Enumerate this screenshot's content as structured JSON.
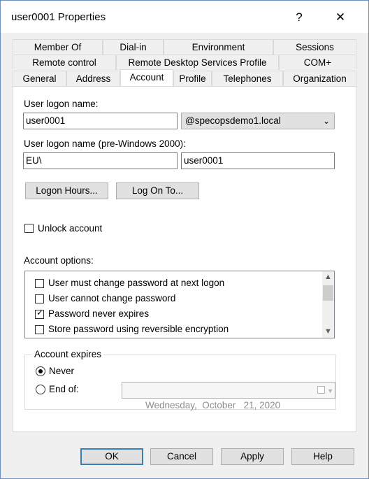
{
  "window": {
    "title": "user0001 Properties",
    "help_glyph": "?",
    "close_glyph": "✕"
  },
  "tabs": {
    "row1": [
      "Member Of",
      "Dial-in",
      "Environment",
      "Sessions"
    ],
    "row2": [
      "Remote control",
      "Remote Desktop Services Profile",
      "COM+"
    ],
    "row3": [
      "General",
      "Address",
      "Account",
      "Profile",
      "Telephones",
      "Organization"
    ],
    "active": "Account"
  },
  "logon": {
    "label": "User logon name:",
    "value": "user0001",
    "domain": "@specopsdemo1.local",
    "pre2000_label": "User logon name (pre-Windows 2000):",
    "pre2000_domain": "EU\\",
    "pre2000_value": "user0001"
  },
  "buttons": {
    "logon_hours": "Logon Hours...",
    "log_on_to": "Log On To..."
  },
  "unlock": {
    "label": "Unlock account",
    "checked": false
  },
  "account_options": {
    "label": "Account options:",
    "items": [
      {
        "label": "User must change password at next logon",
        "checked": false
      },
      {
        "label": "User cannot change password",
        "checked": false
      },
      {
        "label": "Password never expires",
        "checked": true
      },
      {
        "label": "Store password using reversible encryption",
        "checked": false
      }
    ]
  },
  "expires": {
    "title": "Account expires",
    "never_label": "Never",
    "endof_label": "End of:",
    "selected": "never",
    "date_value": "Wednesday,  October   21, 2020"
  },
  "footer": {
    "ok": "OK",
    "cancel": "Cancel",
    "apply": "Apply",
    "help": "Help"
  }
}
